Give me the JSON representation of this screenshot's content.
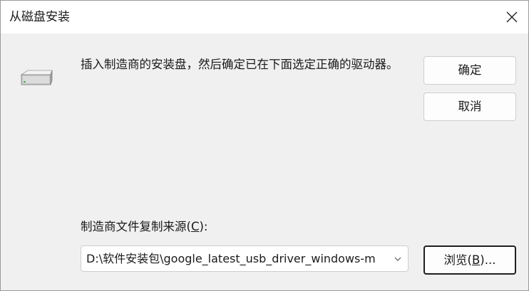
{
  "window": {
    "title": "从磁盘安装"
  },
  "icons": {
    "close": "close-icon",
    "drive": "usb-drive-icon",
    "dropdown": "chevron-down-icon"
  },
  "message": "插入制造商的安装盘，然后确定已在下面选定正确的驱动器。",
  "buttons": {
    "ok_label": "确定",
    "cancel_label": "取消",
    "browse_prefix": "浏览(",
    "browse_accel": "B",
    "browse_suffix": ")..."
  },
  "source": {
    "label_prefix": "制造商文件复制来源(",
    "label_accel": "C",
    "label_suffix": "):",
    "value": "D:\\软件安装包\\google_latest_usb_driver_windows-m"
  }
}
